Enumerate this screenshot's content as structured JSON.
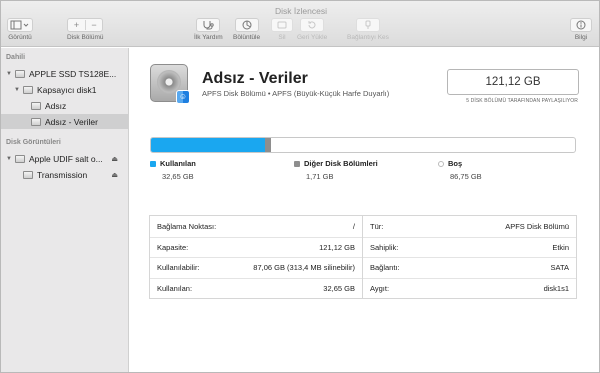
{
  "window": {
    "title": "Disk İzlencesi"
  },
  "toolbar": {
    "view_label": "Görüntü",
    "volume_label": "Disk Bölümü",
    "firstaid_label": "İlk Yardım",
    "partition_label": "Bölüntüle",
    "erase_label": "Sil",
    "restore_label": "Geri Yükle",
    "mount_label": "Bağlantıyı Kes",
    "info_label": "Bilgi"
  },
  "sidebar": {
    "section_internal": "Dahili",
    "items": [
      {
        "label": "APPLE SSD TS128E..."
      },
      {
        "label": "Kapsayıcı disk1"
      },
      {
        "label": "Adsız"
      },
      {
        "label": "Adsız - Veriler"
      }
    ],
    "section_images": "Disk Görüntüleri",
    "image_items": [
      {
        "label": "Apple UDIF salt o..."
      },
      {
        "label": "Transmission"
      }
    ]
  },
  "volume": {
    "name": "Adsız - Veriler",
    "description": "APFS Disk Bölümü • APFS (Büyük-Küçük Harfe Duyarlı)",
    "capacity": "121,12 GB",
    "shared_note": "5 DİSK BÖLÜMÜ TARAFINDAN PAYLAŞILIYOR"
  },
  "usage": {
    "used_fraction": 0.2695,
    "other_fraction": 0.0141,
    "colors": {
      "used": "#1aa7f0",
      "other": "#8e8e8e",
      "free": "#ffffff"
    },
    "legend": [
      {
        "label": "Kullanılan",
        "value": "32,65 GB"
      },
      {
        "label": "Diğer Disk Bölümleri",
        "value": "1,71 GB"
      },
      {
        "label": "Boş",
        "value": "86,75 GB"
      }
    ]
  },
  "info": {
    "left": [
      {
        "k": "Bağlama Noktası:",
        "v": "/"
      },
      {
        "k": "Kapasite:",
        "v": "121,12 GB"
      },
      {
        "k": "Kullanılabilir:",
        "v": "87,06 GB (313,4 MB silinebilir)"
      },
      {
        "k": "Kullanılan:",
        "v": "32,65 GB"
      }
    ],
    "right": [
      {
        "k": "Tür:",
        "v": "APFS Disk Bölümü"
      },
      {
        "k": "Sahiplik:",
        "v": "Etkin"
      },
      {
        "k": "Bağlantı:",
        "v": "SATA"
      },
      {
        "k": "Aygıt:",
        "v": "disk1s1"
      }
    ]
  }
}
